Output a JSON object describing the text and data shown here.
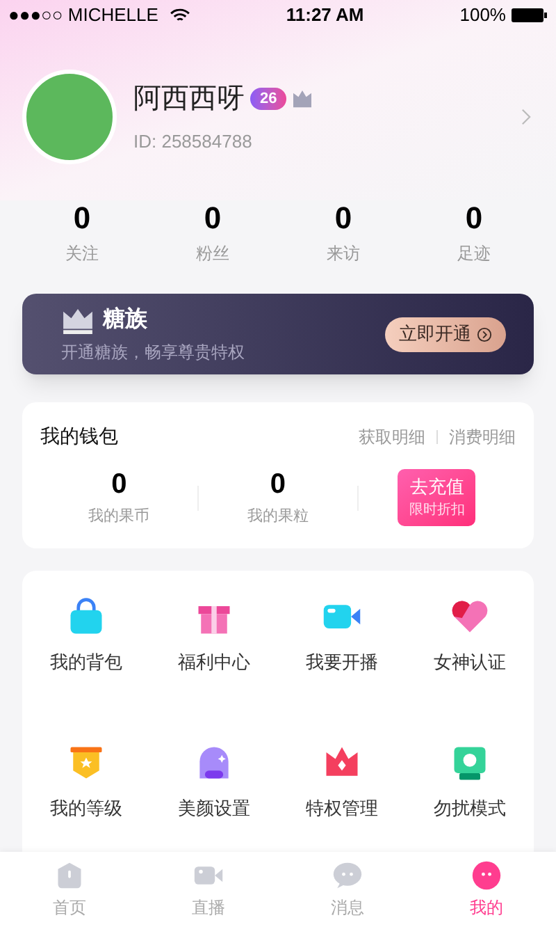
{
  "status_bar": {
    "carrier": "●●●○○ MICHELLE",
    "time": "11:27 AM",
    "battery": "100%"
  },
  "profile": {
    "name": "阿西西呀",
    "level": "26",
    "id": "ID: 258584788"
  },
  "stats": [
    {
      "value": "0",
      "label": "关注"
    },
    {
      "value": "0",
      "label": "粉丝"
    },
    {
      "value": "0",
      "label": "来访"
    },
    {
      "value": "0",
      "label": "足迹"
    }
  ],
  "vip_banner": {
    "title": "糖族",
    "subtitle": "开通糖族，畅享尊贵特权",
    "button": "立即开通"
  },
  "wallet": {
    "title": "我的钱包",
    "links": [
      "获取明细",
      "消费明细"
    ],
    "balances": [
      {
        "value": "0",
        "label": "我的果币"
      },
      {
        "value": "0",
        "label": "我的果粒"
      }
    ],
    "recharge": {
      "label": "去充值",
      "note": "限时折扣"
    }
  },
  "menu": [
    {
      "label": "我的背包"
    },
    {
      "label": "福利中心"
    },
    {
      "label": "我要开播"
    },
    {
      "label": "女神认证"
    },
    {
      "label": "我的等级"
    },
    {
      "label": "美颜设置"
    },
    {
      "label": "特权管理"
    },
    {
      "label": "勿扰模式"
    }
  ],
  "tab_bar": [
    {
      "label": "首页",
      "selected": false
    },
    {
      "label": "直播",
      "selected": false
    },
    {
      "label": "消息",
      "selected": false
    },
    {
      "label": "我的",
      "selected": true
    }
  ]
}
